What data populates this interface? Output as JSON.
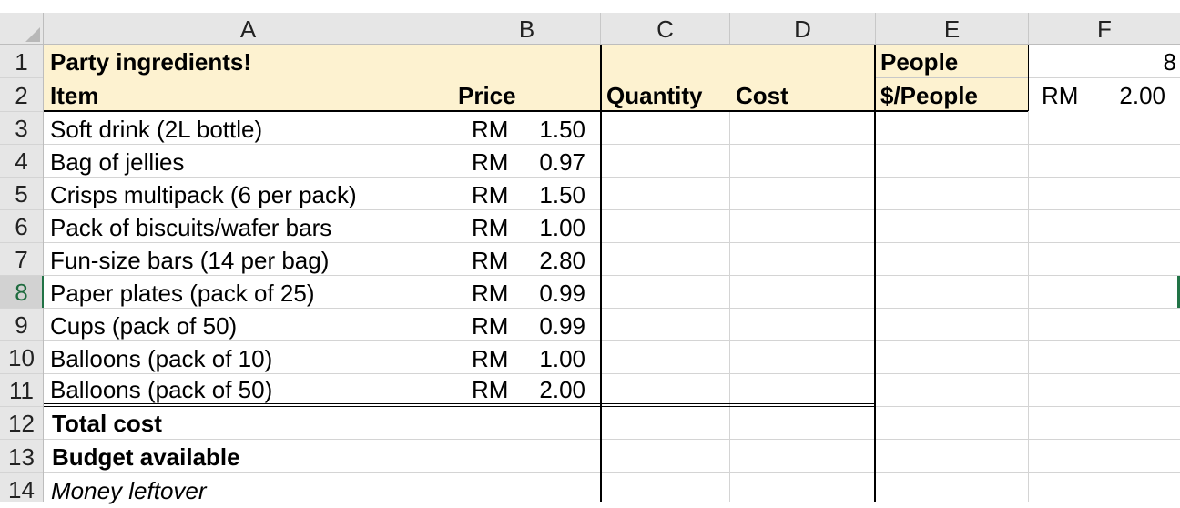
{
  "columns": [
    "A",
    "B",
    "C",
    "D",
    "E",
    "F"
  ],
  "rows": [
    "1",
    "2",
    "3",
    "4",
    "5",
    "6",
    "7",
    "8",
    "9",
    "10",
    "11",
    "12",
    "13",
    "14"
  ],
  "title": "Party ingredients!",
  "headers": {
    "item": "Item",
    "price": "Price",
    "quantity": "Quantity",
    "cost": "Cost"
  },
  "items": [
    {
      "name": "Soft drink (2L bottle)",
      "currency": "RM",
      "price": "1.50"
    },
    {
      "name": "Bag of jellies",
      "currency": "RM",
      "price": "0.97"
    },
    {
      "name": "Crisps multipack (6 per pack)",
      "currency": "RM",
      "price": "1.50"
    },
    {
      "name": "Pack of biscuits/wafer bars",
      "currency": "RM",
      "price": "1.00"
    },
    {
      "name": "Fun-size bars (14 per bag)",
      "currency": "RM",
      "price": "2.80"
    },
    {
      "name": "Paper plates (pack of 25)",
      "currency": "RM",
      "price": "0.99"
    },
    {
      "name": "Cups (pack of 50)",
      "currency": "RM",
      "price": "0.99"
    },
    {
      "name": "Balloons (pack of 10)",
      "currency": "RM",
      "price": "1.00"
    },
    {
      "name": "Balloons (pack of 50)",
      "currency": "RM",
      "price": "2.00"
    }
  ],
  "summary": {
    "total_cost": "Total cost",
    "budget": "Budget available",
    "leftover": "Money leftover"
  },
  "side": {
    "people_label": "People",
    "people_value": "8",
    "per_people_label": "$/People",
    "per_people_currency": "RM",
    "per_people_value": "2.00"
  },
  "colors": {
    "header_fill": "#fdf2d0",
    "grid": "#d4d4d4",
    "selected_row_marker": "#217346"
  }
}
